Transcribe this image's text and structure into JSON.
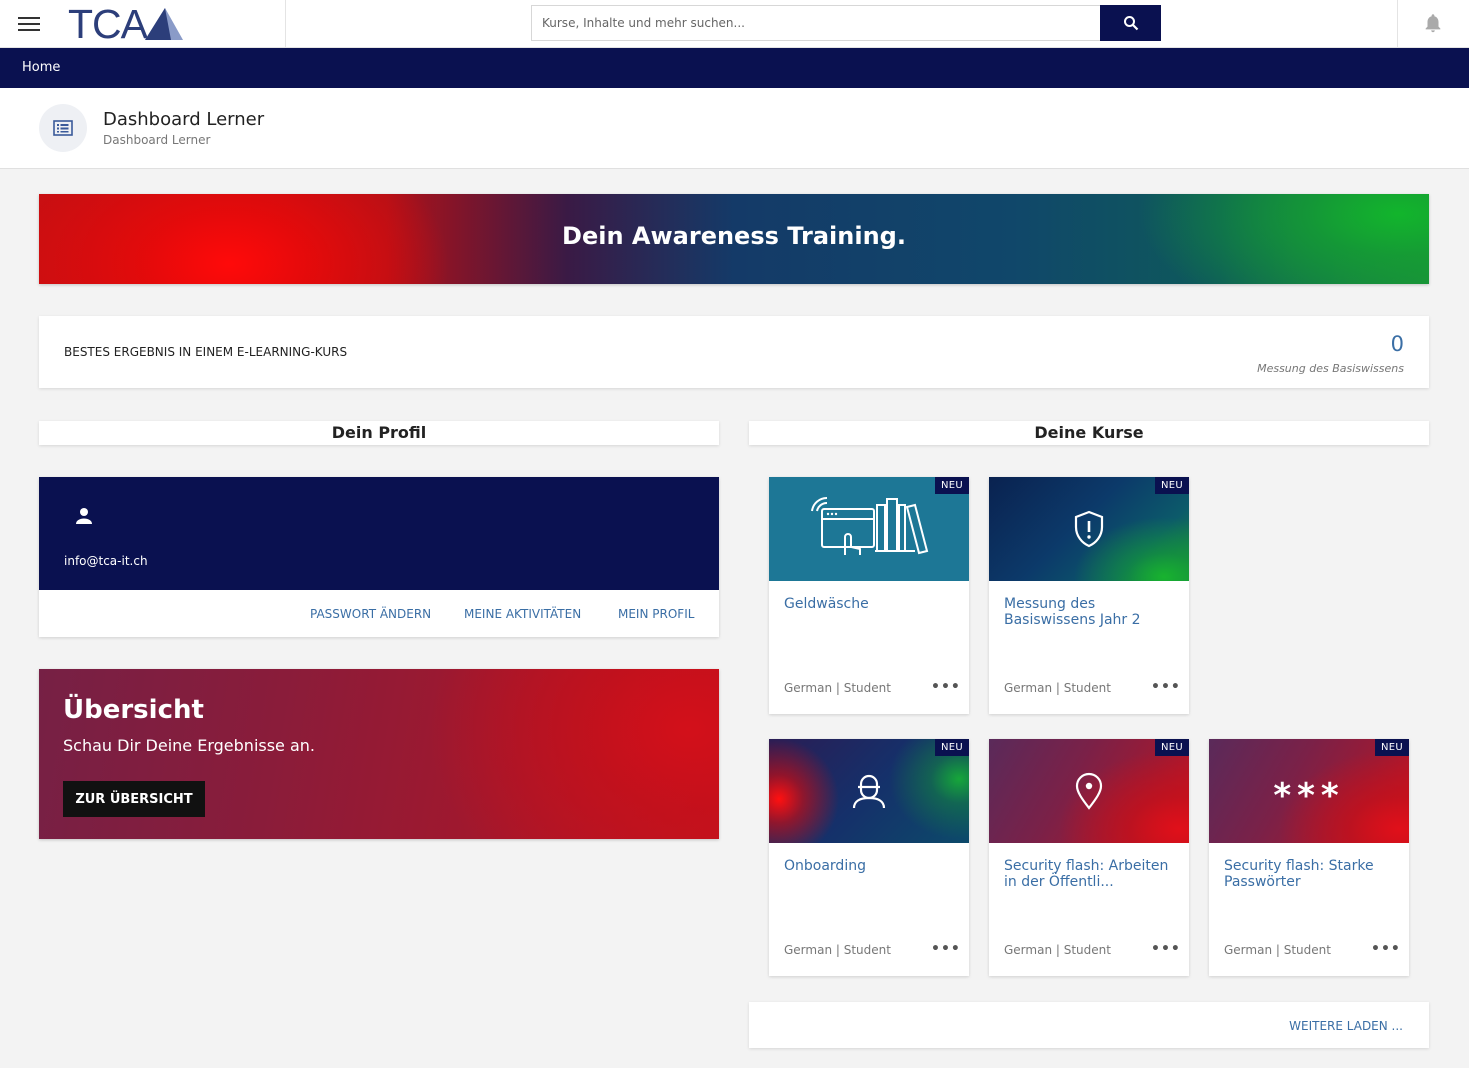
{
  "header": {
    "logo_text": "TCA",
    "search_placeholder": "Kurse, Inhalte und mehr suchen...",
    "icons": [
      "hamburger-icon",
      "search-icon",
      "bell-icon"
    ],
    "accent_color": "#0a1150"
  },
  "nav": {
    "home": "Home"
  },
  "page": {
    "title": "Dashboard Lerner",
    "subtitle": "Dashboard Lerner"
  },
  "banner": {
    "title": "Dein Awareness Training."
  },
  "best_result": {
    "label": "BESTES ERGEBNIS IN EINEM E-LEARNING-KURS",
    "value": "0",
    "sub": "Messung des Basiswissens"
  },
  "profile": {
    "heading": "Dein Profil",
    "email": "info@tca-it.ch",
    "links": {
      "change_password": "PASSWORT ÄNDERN",
      "activities": "MEINE AKTIVITÄTEN",
      "profile": "MEIN PROFIL"
    }
  },
  "overview": {
    "title": "Übersicht",
    "subtitle": "Schau Dir Deine Ergebnisse an.",
    "button": "ZUR ÜBERSICHT"
  },
  "courses": {
    "heading": "Deine Kurse",
    "load_more": "WEITERE LADEN ...",
    "items": [
      {
        "title": "Geldwäsche",
        "badge": "NEU",
        "meta": "German | Student",
        "more": "•••",
        "icon": "online-library-icon"
      },
      {
        "title": "Messung des Basiswissens Jahr 2",
        "badge": "NEU",
        "meta": "German | Student",
        "more": "•••",
        "icon": "shield-exclamation-icon"
      },
      {
        "title": "Onboarding",
        "badge": "NEU",
        "meta": "German | Student",
        "more": "•••",
        "icon": "user-badge-icon"
      },
      {
        "title": "Security flash: Arbeiten in der Öffentli...",
        "badge": "NEU",
        "meta": "German | Student",
        "more": "•••",
        "icon": "location-pin-icon"
      },
      {
        "title": "Security flash: Starke Passwörter",
        "badge": "NEU",
        "meta": "German | Student",
        "more": "•••",
        "icon": "password-asterisks-icon",
        "image_text": "***"
      }
    ]
  }
}
